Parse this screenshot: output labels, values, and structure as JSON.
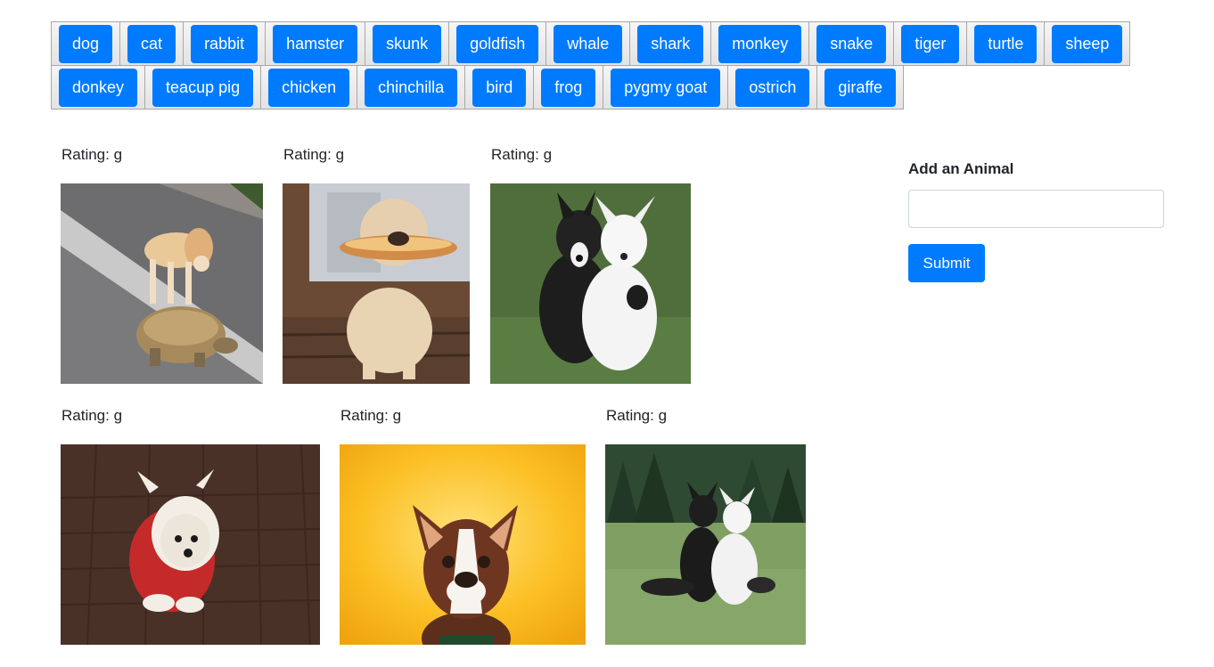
{
  "buttons_row1": [
    "dog",
    "cat",
    "rabbit",
    "hamster",
    "skunk",
    "goldfish",
    "whale",
    "shark",
    "monkey",
    "snake",
    "tiger",
    "turtle",
    "sheep"
  ],
  "buttons_row2": [
    "donkey",
    "teacup pig",
    "chicken",
    "chinchilla",
    "bird",
    "frog",
    "pygmy goat",
    "ostrich",
    "giraffe"
  ],
  "gifs": [
    {
      "rating": "Rating: g",
      "subject": "dog standing on tortoise"
    },
    {
      "rating": "Rating: g",
      "subject": "dog holding hot dog bun"
    },
    {
      "rating": "Rating: g",
      "subject": "two border collies"
    },
    {
      "rating": "Rating: g",
      "subject": "white puppy in reindeer costume"
    },
    {
      "rating": "Rating: g",
      "subject": "boston terrier on yellow"
    },
    {
      "rating": "Rating: g",
      "subject": "two border collies in park"
    }
  ],
  "form": {
    "title": "Add an Animal",
    "input_value": "",
    "submit_label": "Submit"
  },
  "colors": {
    "primary": "#007bff",
    "text": "#212529"
  }
}
